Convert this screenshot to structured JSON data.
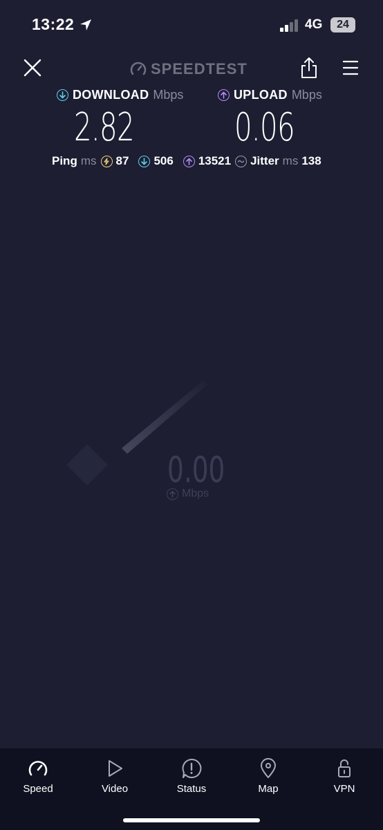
{
  "status_bar": {
    "time": "13:22",
    "network": "4G",
    "battery": "24"
  },
  "header": {
    "brand": "SPEEDTEST"
  },
  "download": {
    "label": "DOWNLOAD",
    "unit": "Mbps",
    "value": "2.82"
  },
  "upload": {
    "label": "UPLOAD",
    "unit": "Mbps",
    "value": "0.06"
  },
  "ping": {
    "label": "Ping",
    "unit": "ms",
    "idle": "87",
    "download": "506",
    "upload": "13521",
    "jitter_label": "Jitter",
    "jitter_unit": "ms",
    "jitter": "138"
  },
  "gauge": {
    "value": "0.00",
    "unit": "Mbps"
  },
  "tabs": [
    {
      "label": "Speed",
      "icon": "speedometer-icon"
    },
    {
      "label": "Video",
      "icon": "play-icon"
    },
    {
      "label": "Status",
      "icon": "alert-bubble-icon"
    },
    {
      "label": "Map",
      "icon": "map-pin-icon"
    },
    {
      "label": "VPN",
      "icon": "lock-icon"
    }
  ],
  "colors": {
    "background": "#1d1e32",
    "download_accent": "#5fd0e6",
    "upload_accent": "#b58cf5",
    "idle_accent": "#f2d27a",
    "tabbar": "#101120"
  }
}
